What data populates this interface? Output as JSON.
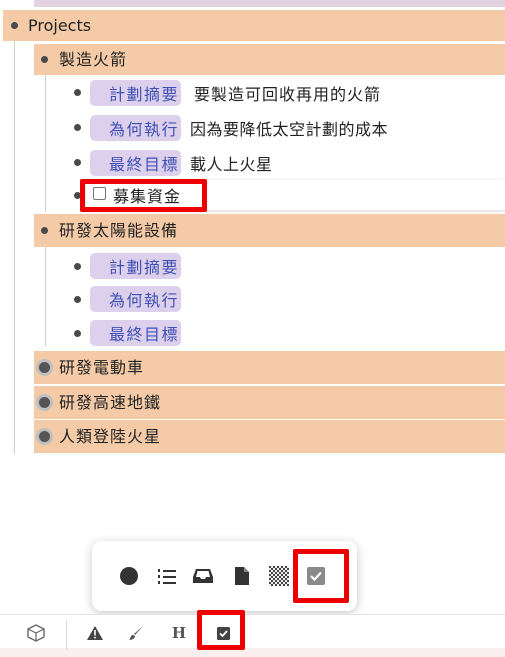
{
  "outline": {
    "root": {
      "label": "Projects"
    },
    "children": [
      {
        "label": "製造火箭",
        "items": [
          {
            "tag": "計劃摘要",
            "text": "要製造可回收再用的火箭"
          },
          {
            "tag": "為何執行",
            "text": "因為要降低太空計劃的成本"
          },
          {
            "tag": "最終目標",
            "text": "載人上火星"
          }
        ],
        "task": {
          "label": "募集資金",
          "checked": false
        }
      },
      {
        "label": "研發太陽能設備",
        "items": [
          {
            "tag": "計劃摘要",
            "text": ""
          },
          {
            "tag": "為何執行",
            "text": ""
          },
          {
            "tag": "最終目標",
            "text": ""
          }
        ]
      },
      {
        "label": "研發電動車",
        "collapsed": true
      },
      {
        "label": "研發高速地鐵",
        "collapsed": true
      },
      {
        "label": "人類登陸火星",
        "collapsed": true
      }
    ]
  },
  "popup_toolbar": {
    "buttons": [
      "bullet-icon",
      "numbered-list-icon",
      "inbox-icon",
      "document-icon",
      "checkerboard-icon",
      "checkbox-icon"
    ],
    "highlighted": "checkbox-icon"
  },
  "bottom_toolbar": {
    "buttons": [
      "box-icon",
      "warning-icon",
      "brush-icon",
      "heading-icon",
      "checkbox-icon"
    ],
    "heading_glyph": "H",
    "highlighted": "checkbox-icon"
  },
  "colors": {
    "highlight": "#f5cba7",
    "tag_bg": "#dcd0ec",
    "tag_text": "#3f51b5",
    "annotation": "#ee0000"
  }
}
